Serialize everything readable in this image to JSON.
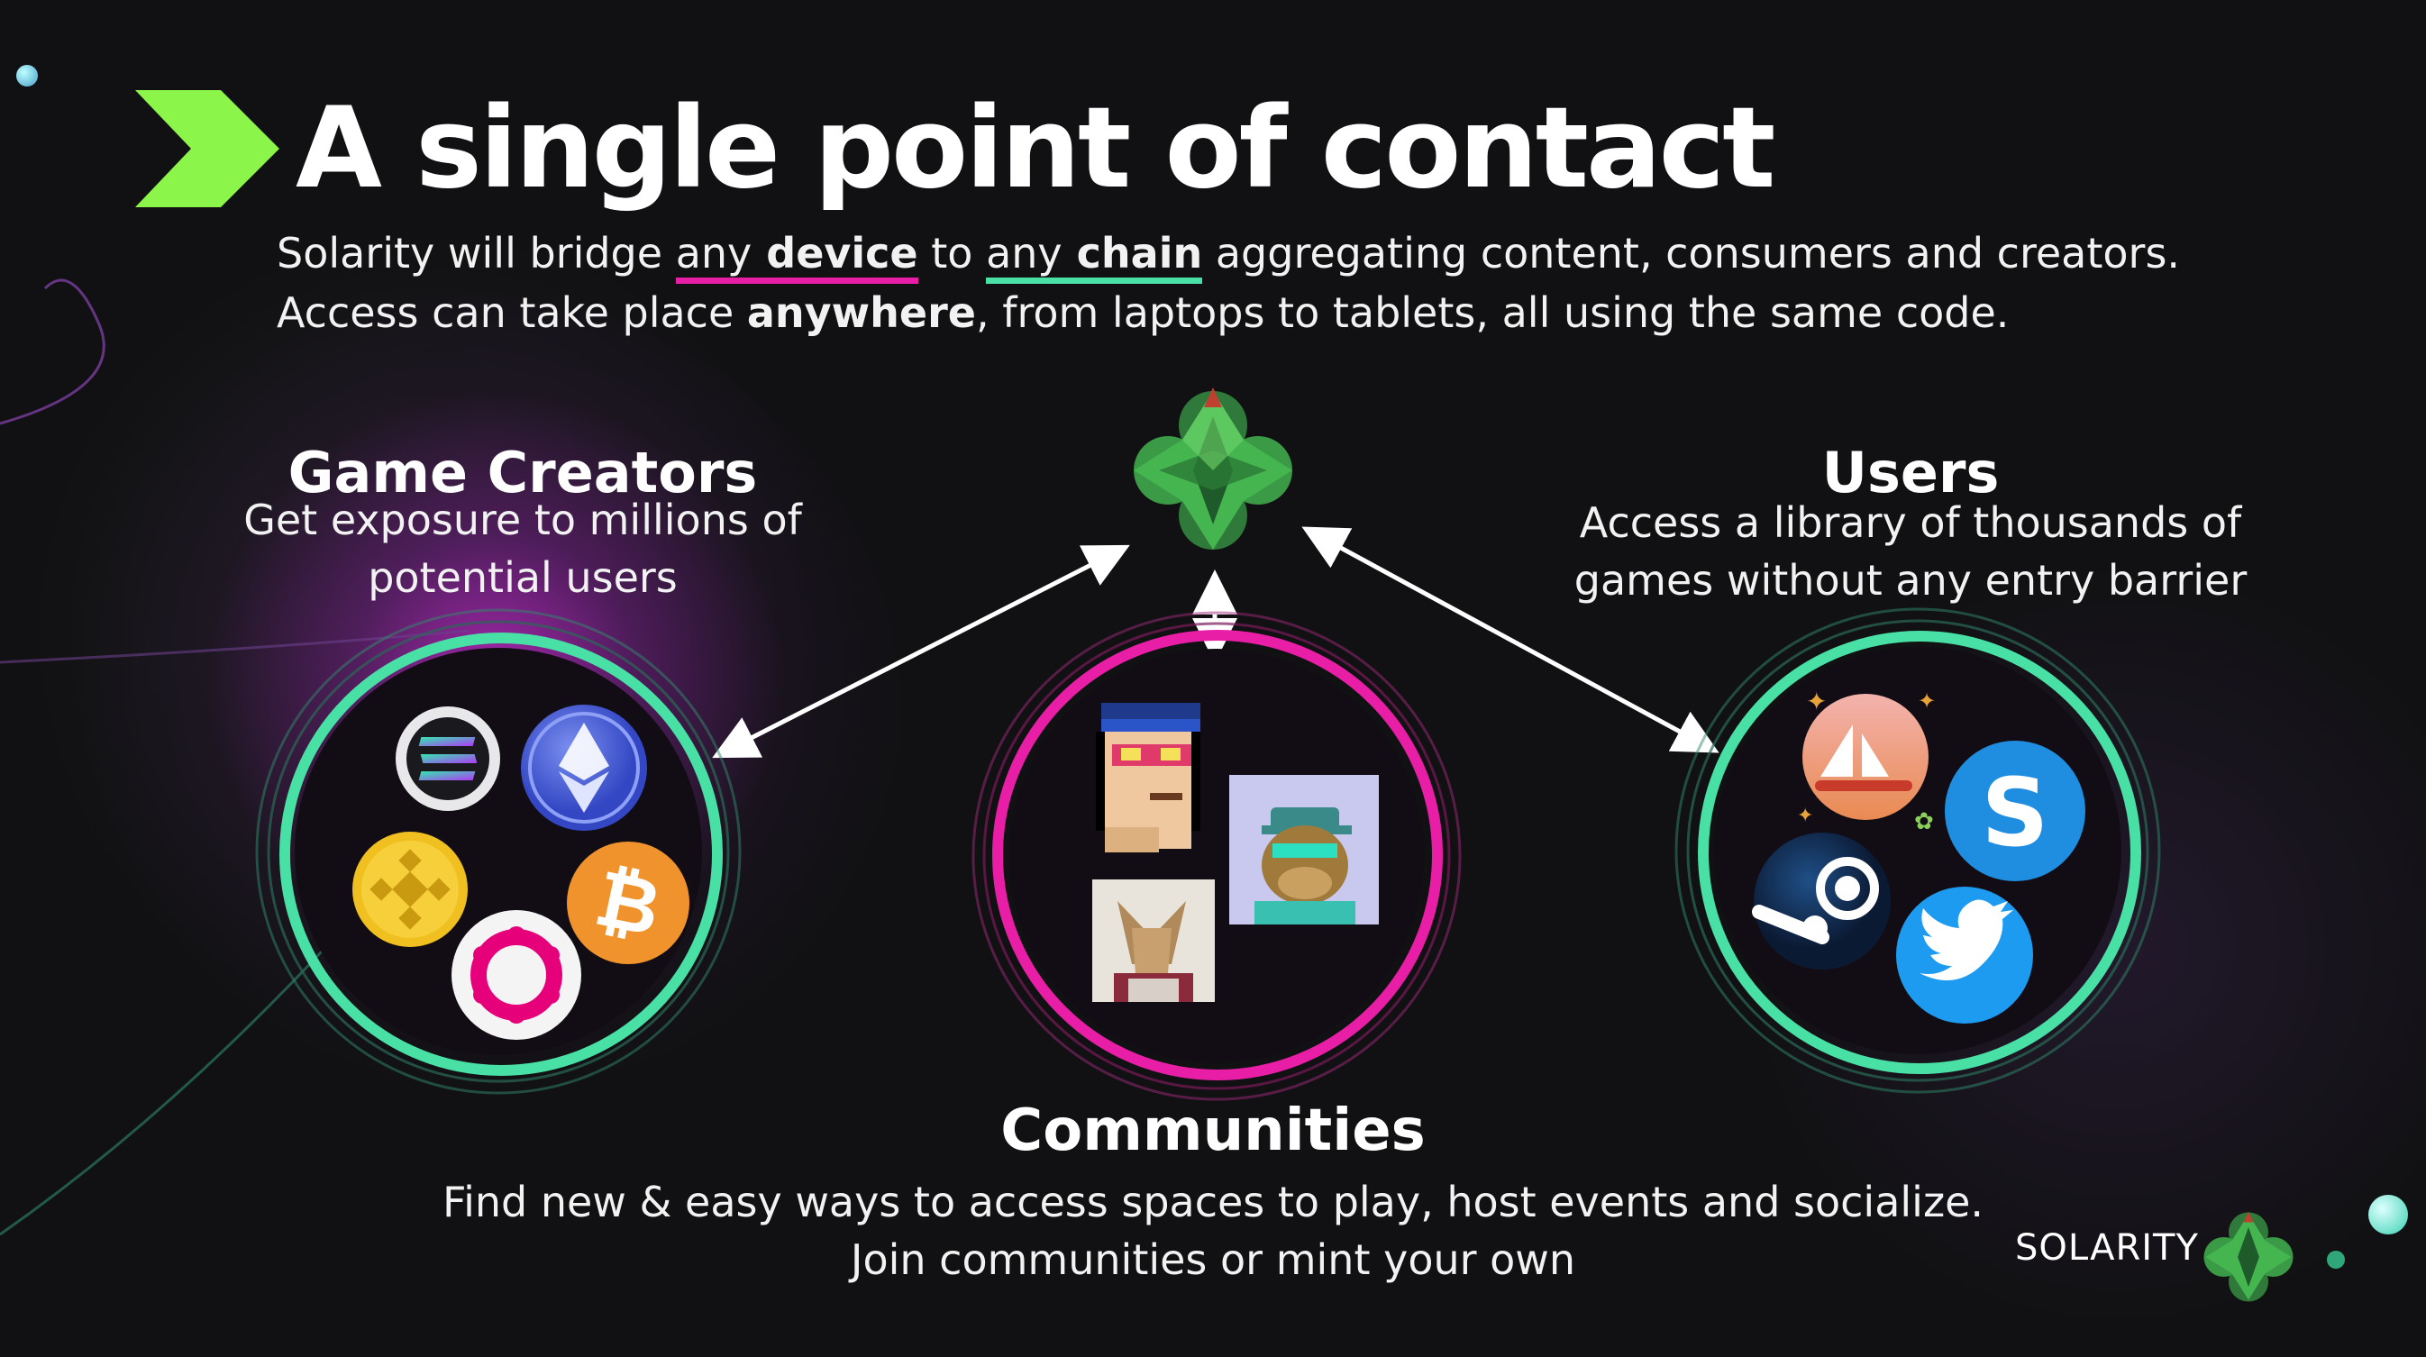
{
  "slide": {
    "title": "A single point of contact",
    "subtitle": {
      "line1_prefix": "Solarity will bridge ",
      "line1_any1": "any",
      "line1_device": " device",
      "line1_to": " to ",
      "line1_any2": "any",
      "line1_chain": " chain",
      "line1_suffix": " aggregating content, consumers and creators.",
      "line2_prefix": "Access can take place ",
      "line2_bold": "anywhere",
      "line2_suffix": ", from laptops to tablets, all using the same code."
    },
    "underline_colors": {
      "device": "#e81fa6",
      "chain": "#49e0a5"
    }
  },
  "game_creators": {
    "heading": "Game Creators",
    "line1": "Get exposure to millions of",
    "line2": "potential users",
    "ring_color": "#49e0a5",
    "icons": [
      "solana-icon",
      "ethereum-icon",
      "binance-icon",
      "bitcoin-icon",
      "polkadot-icon"
    ]
  },
  "users": {
    "heading": "Users",
    "line1": "Access a library of thousands of",
    "line2": "games without any entry barrier",
    "ring_color": "#49e0a5",
    "icons": [
      "opensea-icon",
      "sandbox-icon",
      "steam-icon",
      "twitter-icon"
    ]
  },
  "communities": {
    "heading": "Communities",
    "line1": "Find new & easy ways to access spaces to play, host events and socialize.",
    "line2": "Join communities or mint your own",
    "ring_color": "#e81fa6",
    "icons": [
      "cryptopunk-avatar",
      "ape-avatar",
      "knight-avatar"
    ]
  },
  "brand": {
    "name": "SOLARITY",
    "accent": "#8cf54a",
    "logo_color": "#3aa852"
  }
}
